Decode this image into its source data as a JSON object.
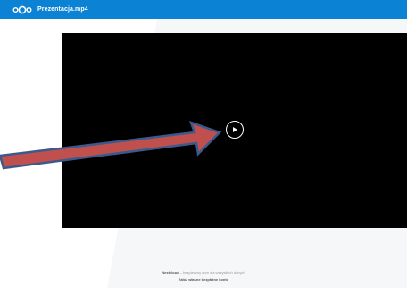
{
  "header": {
    "file_title": "Prezentacja.mp4",
    "background_color": "#0b82d3",
    "logo_icon": "nextcloud-logo-icon"
  },
  "video": {
    "background_color": "#000000",
    "play_icon": "play-circle-icon"
  },
  "annotation": {
    "arrow_color": "#c0504d",
    "arrow_outline_color": "#3a5a8c"
  },
  "footer": {
    "brand": "Nextcloud",
    "tagline": " – bezpieczny dom dla wszystkich danych",
    "signup_label": "Załóż własne bezpłatne konto"
  }
}
